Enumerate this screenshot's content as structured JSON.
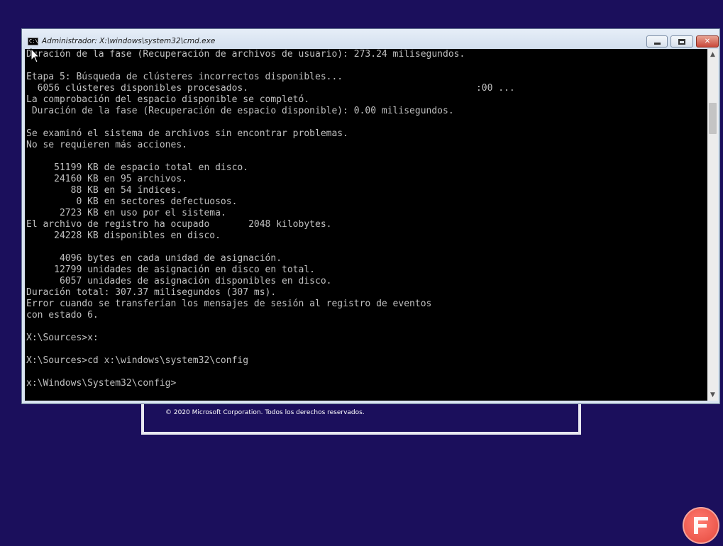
{
  "window": {
    "title": "Administrador: X:\\windows\\system32\\cmd.exe",
    "icon_text": "C:\\",
    "buttons": {
      "minimize": "minimize-icon",
      "maximize": "maximize-icon",
      "close": "close-icon",
      "close_glyph": "✕"
    }
  },
  "console": {
    "lines": [
      "Duración de la fase (Recuperación de archivos de usuario): 273.24 milisegundos.",
      "",
      "Etapa 5: Búsqueda de clústeres incorrectos disponibles...",
      "  6056 clústeres disponibles procesados.                                         :00 ...",
      "La comprobación del espacio disponible se completó.",
      " Duración de la fase (Recuperación de espacio disponible): 0.00 milisegundos.",
      "",
      "Se examinó el sistema de archivos sin encontrar problemas.",
      "No se requieren más acciones.",
      "",
      "     51199 KB de espacio total en disco.",
      "     24160 KB en 95 archivos.",
      "        88 KB en 54 índices.",
      "         0 KB en sectores defectuosos.",
      "      2723 KB en uso por el sistema.",
      "El archivo de registro ha ocupado       2048 kilobytes.",
      "     24228 KB disponibles en disco.",
      "",
      "      4096 bytes en cada unidad de asignación.",
      "     12799 unidades de asignación en disco en total.",
      "      6057 unidades de asignación disponibles en disco.",
      "Duración total: 307.37 milisegundos (307 ms).",
      "Error cuando se transferían los mensajes de sesión al registro de eventos",
      "con estado 6.",
      "",
      "X:\\Sources>x:",
      "",
      "X:\\Sources>cd x:\\windows\\system32\\config",
      "",
      "x:\\Windows\\System32\\config>"
    ]
  },
  "scrollbar": {
    "up_arrow": "▲",
    "down_arrow": "▼"
  },
  "background": {
    "copyright": "© 2020 Microsoft Corporation. Todos los derechos reservados."
  },
  "colors": {
    "desktop_bg": "#1b0f5c",
    "console_bg": "#000000",
    "console_text": "#c0c0c0",
    "close_button": "#c9483a"
  }
}
